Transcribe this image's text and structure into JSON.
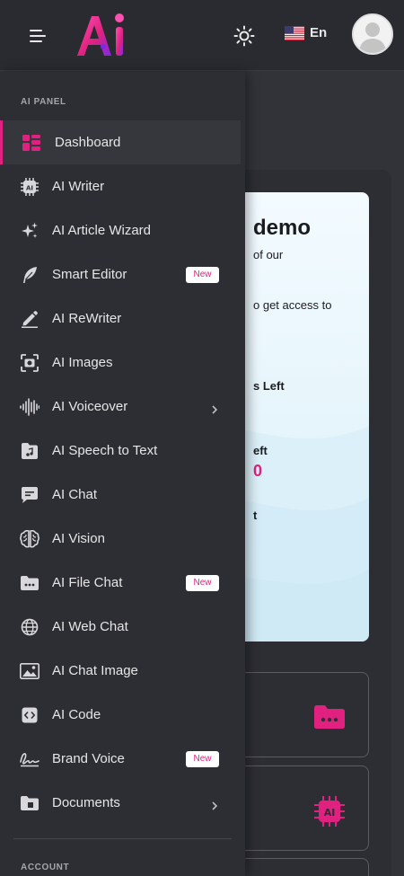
{
  "header": {
    "language": "En",
    "logo_text": "Ai"
  },
  "demo": {
    "heading": "demo",
    "line1": "of our",
    "line2": "o get access to",
    "left1": "s Left",
    "left2": "eft",
    "number": "0",
    "left3": "t"
  },
  "sidebar": {
    "section_ai": "AI PANEL",
    "section_account": "ACCOUNT",
    "items": [
      {
        "label": "Dashboard",
        "icon": "dashboard-icon",
        "active": true
      },
      {
        "label": "AI Writer",
        "icon": "ai-chip-icon"
      },
      {
        "label": "AI Article Wizard",
        "icon": "sparkles-icon"
      },
      {
        "label": "Smart Editor",
        "icon": "feather-icon",
        "badge": "New"
      },
      {
        "label": "AI ReWriter",
        "icon": "pen-icon"
      },
      {
        "label": "AI Images",
        "icon": "image-scan-icon"
      },
      {
        "label": "AI Voiceover",
        "icon": "waveform-icon",
        "submenu": true
      },
      {
        "label": "AI Speech to Text",
        "icon": "audio-file-icon"
      },
      {
        "label": "AI Chat",
        "icon": "chat-icon"
      },
      {
        "label": "AI Vision",
        "icon": "brain-icon"
      },
      {
        "label": "AI File Chat",
        "icon": "folder-dots-icon",
        "badge": "New"
      },
      {
        "label": "AI Web Chat",
        "icon": "globe-icon"
      },
      {
        "label": "AI Chat Image",
        "icon": "picture-icon"
      },
      {
        "label": "AI Code",
        "icon": "code-icon"
      },
      {
        "label": "Brand Voice",
        "icon": "signature-icon",
        "badge": "New"
      },
      {
        "label": "Documents",
        "icon": "documents-icon",
        "submenu": true
      }
    ]
  },
  "colors": {
    "accent": "#e0217f",
    "sidebar_bg": "#2d2e33",
    "header_bg": "#2a2b30"
  }
}
